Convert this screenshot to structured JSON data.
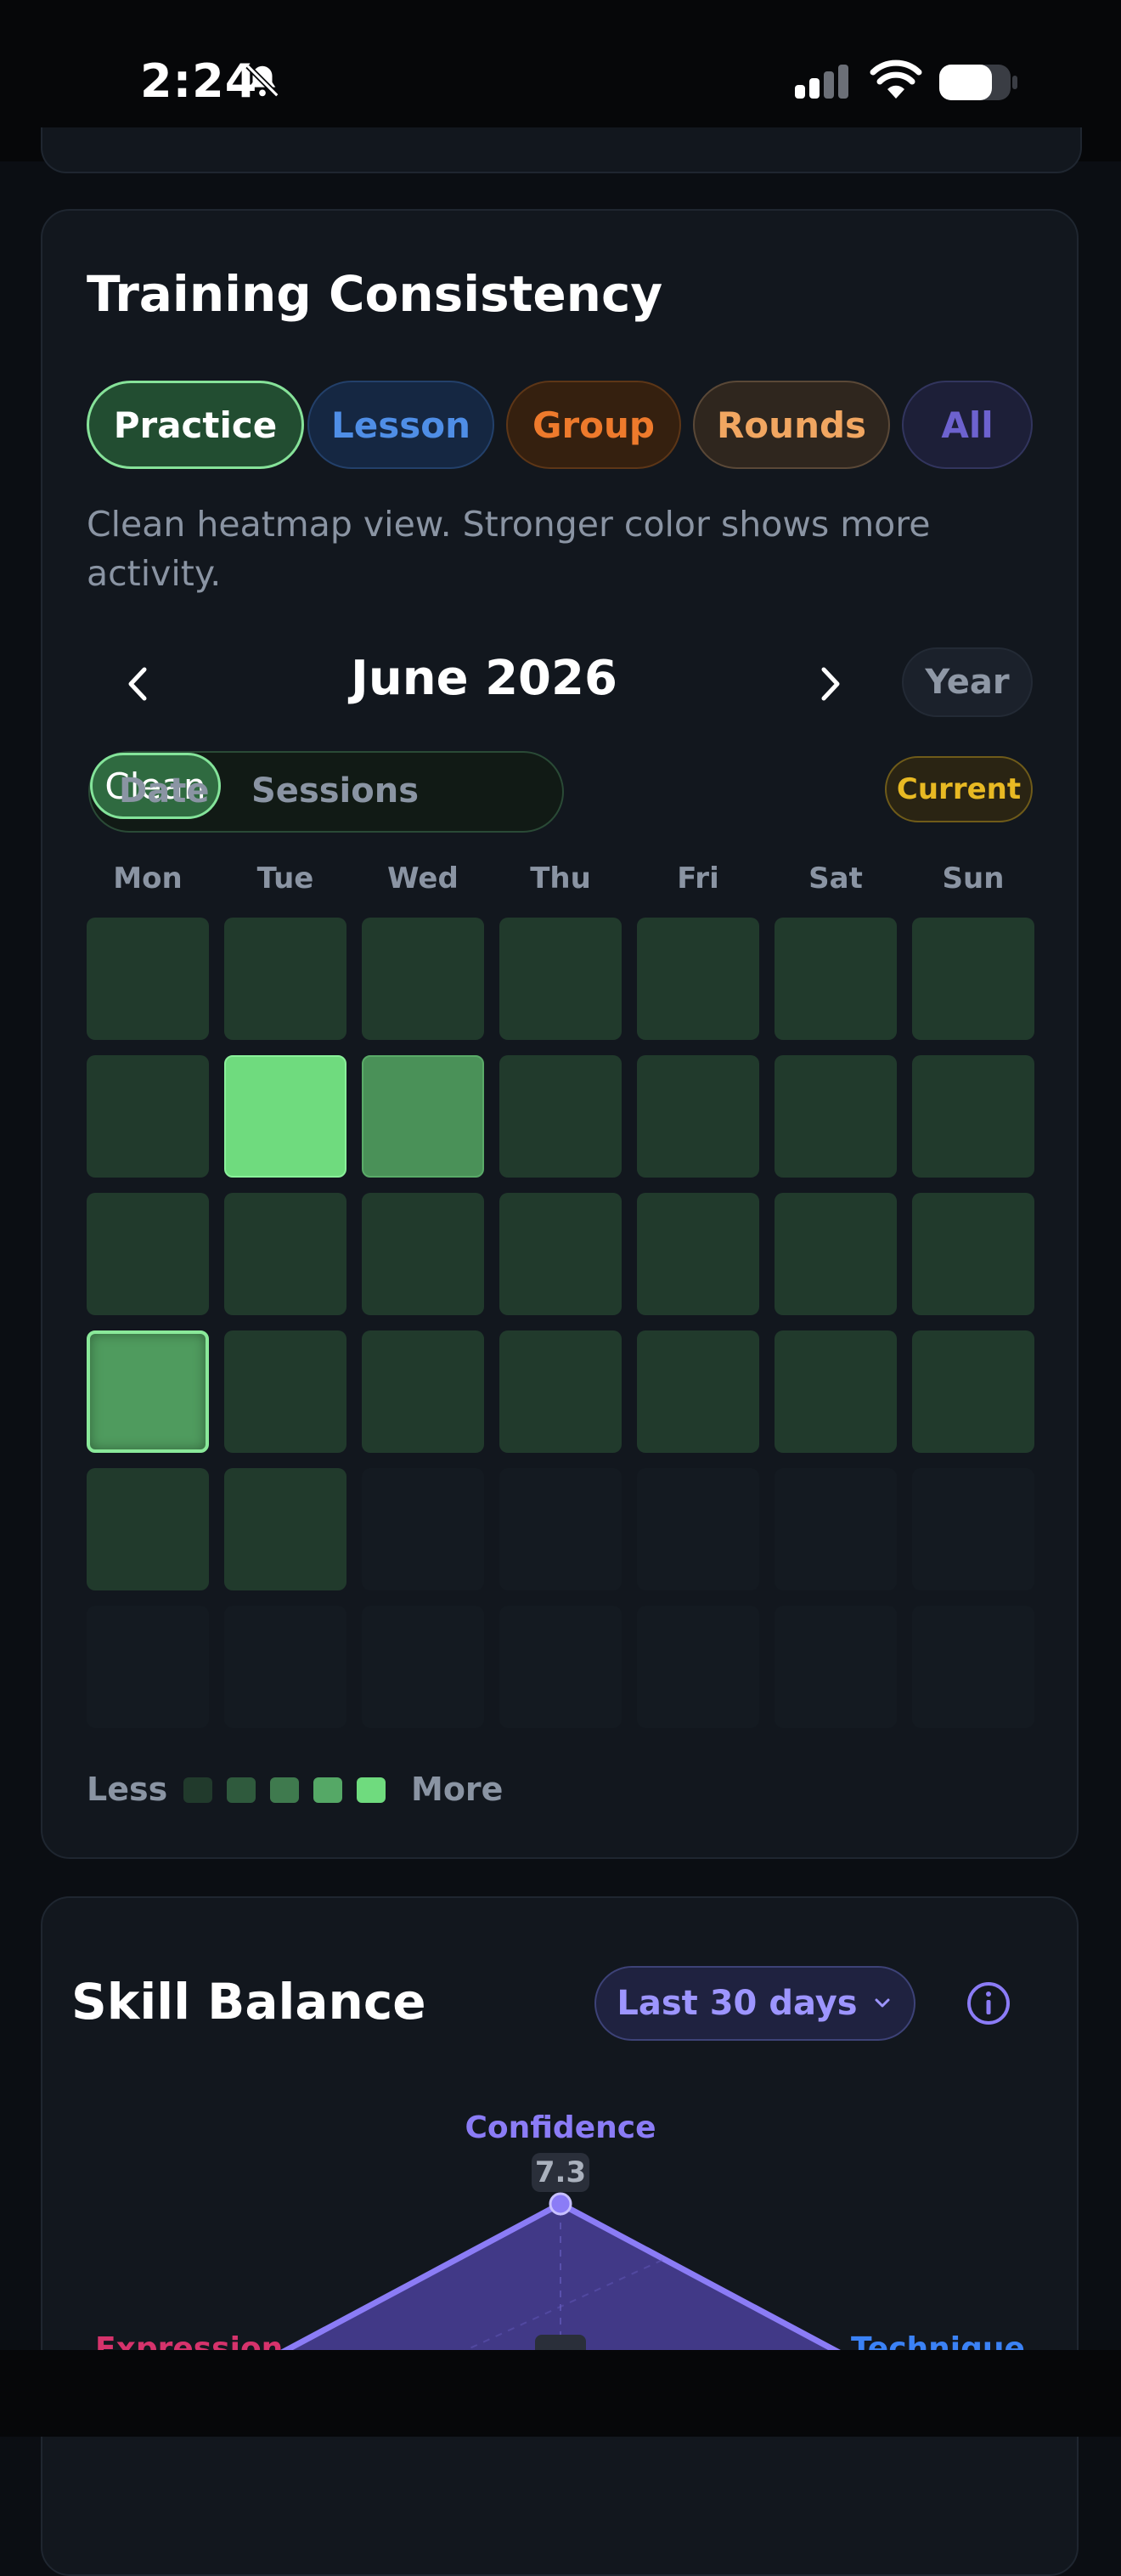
{
  "status_bar": {
    "time": "2:24"
  },
  "training": {
    "title": "Training Consistency",
    "chips": [
      "Practice",
      "Lesson",
      "Group",
      "Rounds",
      "All"
    ],
    "description": "Clean heatmap view. Stronger color shows more activity.",
    "month": "June 2026",
    "year_button": "Year",
    "view_modes": [
      "Date",
      "Sessions",
      "Clean"
    ],
    "selected_view": "Clean",
    "current_button": "Current",
    "weekdays": [
      "Mon",
      "Tue",
      "Wed",
      "Thu",
      "Fri",
      "Sat",
      "Sun"
    ],
    "heatmap_levels": [
      [
        1,
        1,
        1,
        1,
        1,
        1,
        1
      ],
      [
        1,
        4,
        3,
        1,
        1,
        1,
        1
      ],
      [
        1,
        1,
        1,
        1,
        1,
        1,
        1
      ],
      [
        "today",
        1,
        1,
        1,
        1,
        1,
        1
      ],
      [
        1,
        1,
        0,
        0,
        0,
        0,
        0
      ],
      [
        0,
        0,
        0,
        0,
        0,
        0,
        0
      ]
    ],
    "legend": {
      "less": "Less",
      "more": "More",
      "colors": [
        "#213a2c",
        "#2f5a3d",
        "#3f7a4e",
        "#55a866",
        "#6fdb7e"
      ]
    }
  },
  "skill_balance": {
    "title": "Skill Balance",
    "range": "Last 30 days",
    "axes": [
      {
        "name": "Confidence",
        "value": "7.3",
        "color": "#8b7cf6"
      },
      {
        "name": "Expression",
        "color": "#d6336c"
      },
      {
        "name": "Technique",
        "color": "#3b82f6"
      }
    ]
  },
  "colors": {
    "accent_green": "#6fdb7e",
    "accent_purple": "#8b7cf6",
    "warning": "#e8b923"
  }
}
